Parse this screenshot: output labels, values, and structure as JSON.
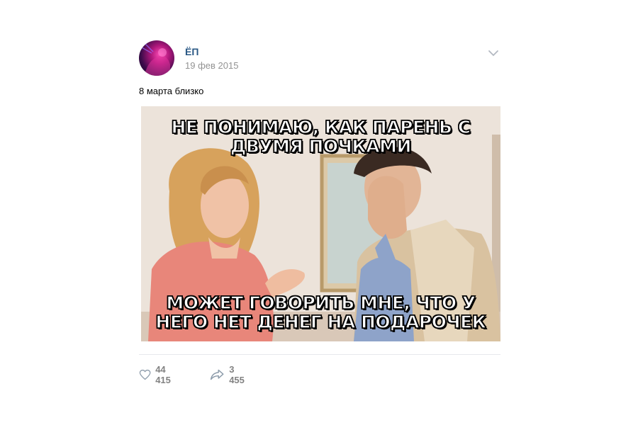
{
  "post": {
    "author": "ЁП",
    "date": "19 фев 2015",
    "text": "8 марта близко",
    "meme": {
      "caption_top": "НЕ ПОНИМАЮ, КАК ПАРЕНЬ С ДВУМЯ ПОЧКАМИ",
      "caption_bottom": "МОЖЕТ ГОВОРИТЬ МНЕ, ЧТО У НЕГО НЕТ ДЕНЕГ НА ПОДАРОЧЕК"
    },
    "likes": "44 415",
    "shares": "3 455"
  },
  "icons": {
    "like": "heart-icon",
    "share": "share-arrow-icon",
    "menu": "chevron-down-icon"
  },
  "colors": {
    "author": "#2a5885",
    "meta": "#939393",
    "counts": "#828282"
  }
}
